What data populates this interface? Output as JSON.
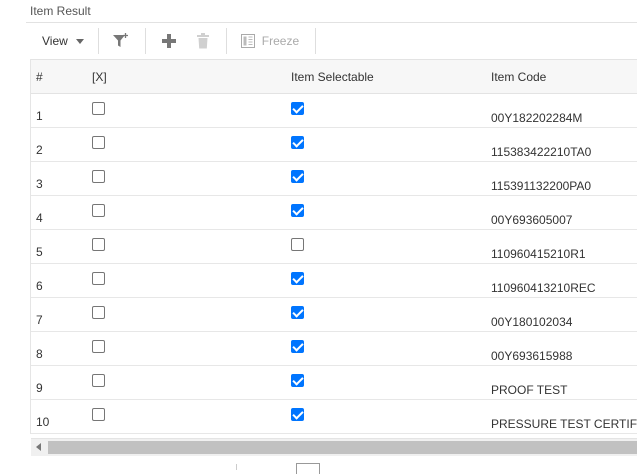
{
  "section": {
    "title": "Item Result"
  },
  "toolbar": {
    "view_label": "View",
    "freeze_label": "Freeze",
    "icons": [
      "caret-down-icon",
      "filter-plus-icon",
      "plus-icon",
      "trash-icon",
      "freeze-icon"
    ]
  },
  "table": {
    "columns": [
      "#",
      "[X]",
      "Item Selectable",
      "Item Code"
    ],
    "rows": [
      {
        "num": "1",
        "x": false,
        "selectable": true,
        "code": "00Y182202284M"
      },
      {
        "num": "2",
        "x": false,
        "selectable": true,
        "code": "115383422210TA0"
      },
      {
        "num": "3",
        "x": false,
        "selectable": true,
        "code": "115391132200PA0"
      },
      {
        "num": "4",
        "x": false,
        "selectable": true,
        "code": "00Y693605007"
      },
      {
        "num": "5",
        "x": false,
        "selectable": false,
        "code": "110960415210R1"
      },
      {
        "num": "6",
        "x": false,
        "selectable": true,
        "code": "110960413210REC"
      },
      {
        "num": "7",
        "x": false,
        "selectable": true,
        "code": "00Y180102034"
      },
      {
        "num": "8",
        "x": false,
        "selectable": true,
        "code": "00Y693615988"
      },
      {
        "num": "9",
        "x": false,
        "selectable": true,
        "code": "PROOF TEST"
      },
      {
        "num": "10",
        "x": false,
        "selectable": true,
        "code": "PRESSURE TEST CERTIFICATE"
      }
    ]
  },
  "colors": {
    "checkbox_checked": "#0075ff",
    "header_bg": "#f7f7f7",
    "scroll_thumb": "#c1c1c1"
  }
}
